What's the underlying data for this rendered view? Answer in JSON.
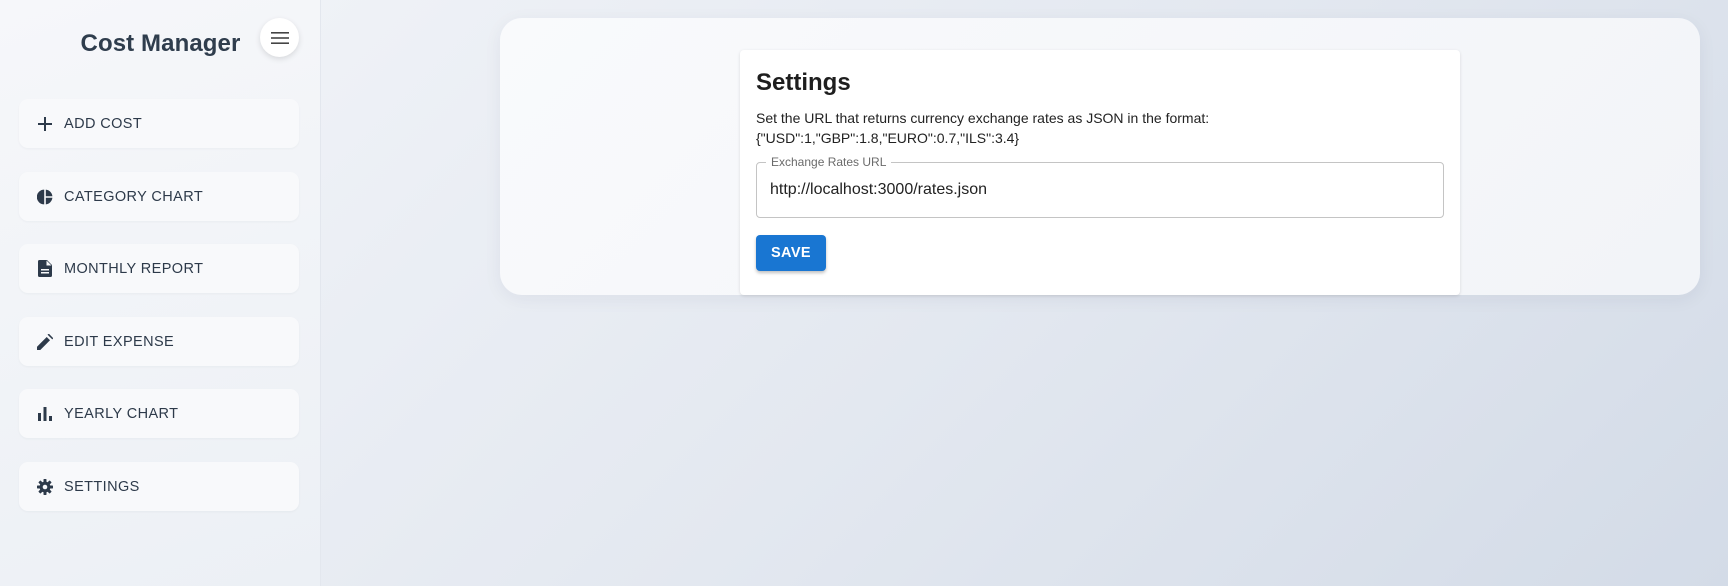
{
  "app": {
    "title": "Cost Manager"
  },
  "sidebar": {
    "toggle_icon": "hamburger-menu-icon",
    "items": [
      {
        "label": "ADD COST",
        "icon": "plus-icon"
      },
      {
        "label": "CATEGORY CHART",
        "icon": "pie-chart-icon"
      },
      {
        "label": "MONTHLY REPORT",
        "icon": "document-icon"
      },
      {
        "label": "EDIT EXPENSE",
        "icon": "pencil-icon"
      },
      {
        "label": "YEARLY CHART",
        "icon": "bar-chart-icon"
      },
      {
        "label": "SETTINGS",
        "icon": "gear-icon"
      }
    ]
  },
  "settings": {
    "title": "Settings",
    "description_line1": "Set the URL that returns currency exchange rates as JSON in the format:",
    "description_line2": "{\"USD\":1,\"GBP\":1.8,\"EURO\":0.7,\"ILS\":3.4}",
    "field_label": "Exchange Rates URL",
    "field_value": "http://localhost:3000/rates.json",
    "save_label": "SAVE"
  },
  "colors": {
    "accent": "#1976d2",
    "text_dark": "#2d3a4a",
    "background": "#e3e8f0"
  }
}
